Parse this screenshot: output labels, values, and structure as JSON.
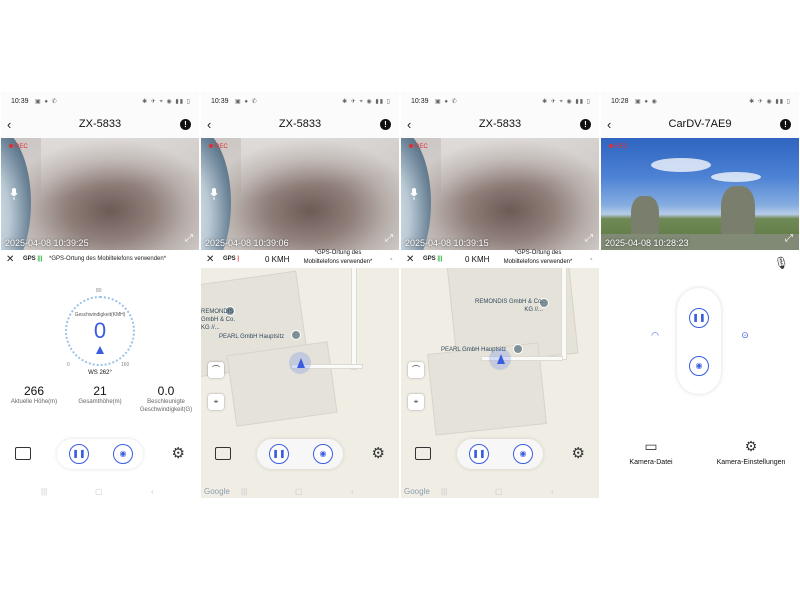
{
  "colors": {
    "accent": "#3a5ce0",
    "rec": "#e03030",
    "gps_signal": "#2fae3b"
  },
  "phones": [
    {
      "time": "10:39",
      "title": "ZX-5833",
      "rec": "REC",
      "timestamp": "2025-04-08 10:39:25",
      "gps_label": "GPS",
      "use_phone_gps": "*GPS-Ortung des Mobiltelefons verwenden*",
      "dashboard": {
        "gauge_label": "Geschwindigkeit(KMH)",
        "speed": "0",
        "heading": "WS 262°",
        "tick_min": "0",
        "tick_max": "160",
        "tick_mid": "80",
        "stats": [
          {
            "value": "266",
            "label": "Aktuelle Höhe(m)"
          },
          {
            "value": "21",
            "label": "Gesamthöhe(m)"
          },
          {
            "value": "0.0",
            "label": "Beschleunigte Geschwindigkeit(G)"
          }
        ]
      }
    },
    {
      "time": "10:39",
      "title": "ZX-5833",
      "rec": "REC",
      "timestamp": "2025-04-08 10:39:06",
      "gps_label": "GPS",
      "speed": "0 KMH",
      "use_phone_gps": "*GPS-Ortung des Mobiltelefons verwenden*",
      "map_labels": [
        "REMONDIS GmbH & Co. KG //...",
        "PEARL GmbH Hauptsitz"
      ],
      "google": "Google"
    },
    {
      "time": "10:39",
      "title": "ZX-5833",
      "rec": "REC",
      "timestamp": "2025-04-08 10:39:15",
      "gps_label": "GPS",
      "speed": "0 KMH",
      "use_phone_gps": "*GPS-Ortung des Mobiltelefons verwenden*",
      "map_labels": [
        "REMONDIS GmbH & Co. KG //...",
        "PEARL GmbH Hauptsitz"
      ],
      "google": "Google"
    },
    {
      "time": "10:28",
      "title": "CarDV-7AE9",
      "rec": "REC",
      "timestamp": "2025-04-08 10:28:23",
      "camera_file": "Kamera-Datei",
      "camera_settings": "Kamera-Einstellungen"
    }
  ]
}
